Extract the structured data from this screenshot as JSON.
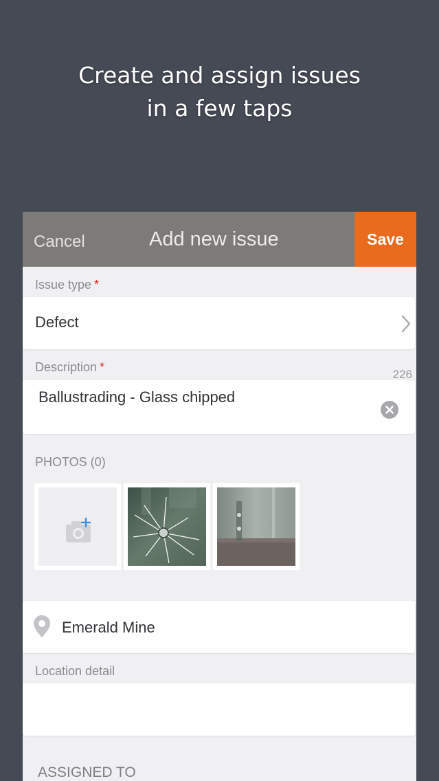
{
  "promo": {
    "line1": "Create and assign issues",
    "line2": "in a few taps"
  },
  "navbar": {
    "cancel_label": "Cancel",
    "title": "Add new issue",
    "save_label": "Save"
  },
  "issue_type": {
    "label": "Issue type",
    "required_mark": "*",
    "value": "Defect"
  },
  "description": {
    "label": "Description",
    "required_mark": "*",
    "remaining_count": "226",
    "value": "Ballustrading - Glass chipped"
  },
  "photos": {
    "label": "PHOTOS (0)",
    "items": [
      "add-photo",
      "cracked-glass-photo",
      "glass-balustrade-photo"
    ]
  },
  "location": {
    "value": "Emerald Mine",
    "detail_label": "Location detail",
    "detail_value": ""
  },
  "assigned_to": {
    "label": "ASSIGNED TO"
  },
  "colors": {
    "background": "#454a55",
    "navbar": "#7c7b77",
    "save_accent": "#e96b1e",
    "required": "#d8322c"
  }
}
